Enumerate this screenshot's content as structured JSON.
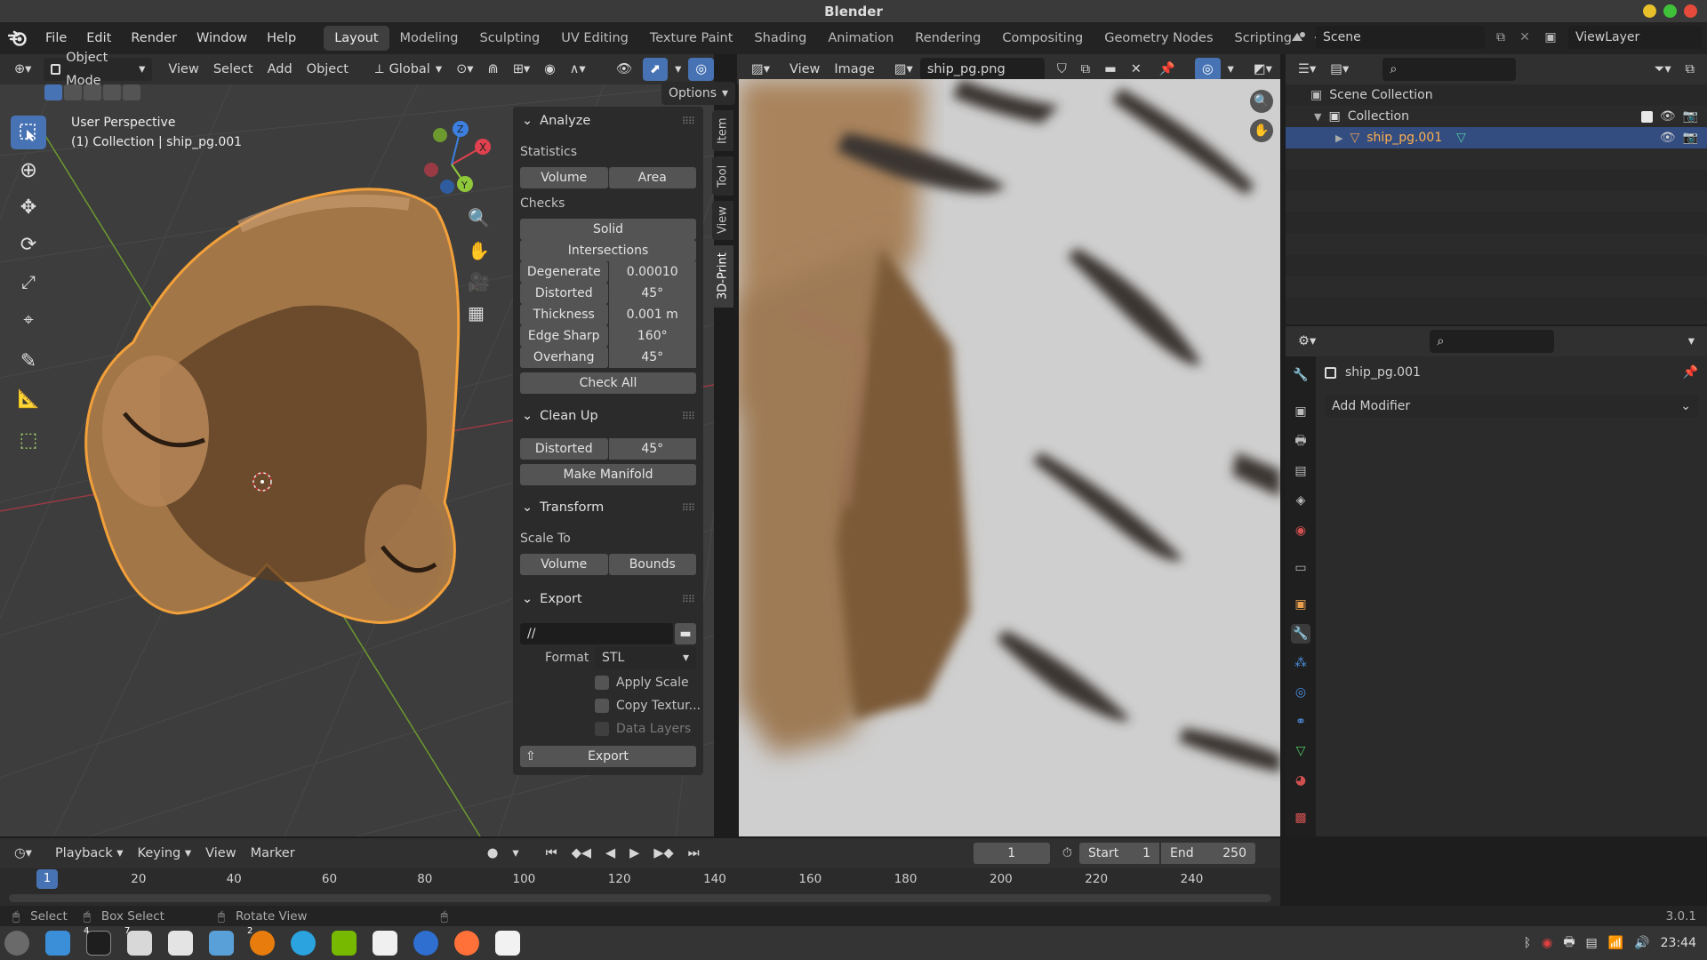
{
  "window": {
    "title": "Blender"
  },
  "menu": [
    "File",
    "Edit",
    "Render",
    "Window",
    "Help"
  ],
  "workspaces": [
    "Layout",
    "Modeling",
    "Sculpting",
    "UV Editing",
    "Texture Paint",
    "Shading",
    "Animation",
    "Rendering",
    "Compositing",
    "Geometry Nodes",
    "Scripting"
  ],
  "active_workspace": "Layout",
  "scene": {
    "label": "Scene",
    "viewlayer": "ViewLayer"
  },
  "viewport_header": {
    "mode": "Object Mode",
    "view": "View",
    "select": "Select",
    "add": "Add",
    "object": "Object",
    "orientation": "Global",
    "options": "Options"
  },
  "viewport": {
    "perspective": "User Perspective",
    "collection_info": "(1) Collection | ship_pg.001"
  },
  "side_tabs": [
    "Item",
    "Tool",
    "View",
    "3D-Print"
  ],
  "analyze": {
    "title": "Analyze",
    "statistics": "Statistics",
    "volume": "Volume",
    "area": "Area",
    "checks": "Checks",
    "solid": "Solid",
    "intersections": "Intersections",
    "rows": [
      {
        "label": "Degenerate",
        "value": "0.00010"
      },
      {
        "label": "Distorted",
        "value": "45°"
      },
      {
        "label": "Thickness",
        "value": "0.001 m"
      },
      {
        "label": "Edge Sharp",
        "value": "160°"
      },
      {
        "label": "Overhang",
        "value": "45°"
      }
    ],
    "check_all": "Check All"
  },
  "cleanup": {
    "title": "Clean Up",
    "distorted": "Distorted",
    "distorted_value": "45°",
    "make_manifold": "Make Manifold"
  },
  "transform": {
    "title": "Transform",
    "scale_to": "Scale To",
    "volume": "Volume",
    "bounds": "Bounds"
  },
  "export": {
    "title": "Export",
    "path": "//",
    "format_label": "Format",
    "format": "STL",
    "apply_scale": "Apply Scale",
    "copy_textures": "Copy Textur...",
    "data_layers": "Data Layers",
    "export_btn": "Export"
  },
  "image_editor": {
    "view": "View",
    "image": "Image",
    "filename": "ship_pg.png"
  },
  "outliner": {
    "scene_collection": "Scene Collection",
    "collection": "Collection",
    "object": "ship_pg.001"
  },
  "properties": {
    "object": "ship_pg.001",
    "add_modifier": "Add Modifier"
  },
  "timeline": {
    "playback": "Playback",
    "keying": "Keying",
    "view": "View",
    "marker": "Marker",
    "current_frame": "1",
    "start_label": "Start",
    "start": "1",
    "end_label": "End",
    "end": "250",
    "ticks": [
      "20",
      "40",
      "60",
      "80",
      "100",
      "120",
      "140",
      "160",
      "180",
      "200",
      "220",
      "240"
    ],
    "cursor": "1"
  },
  "statusbar": {
    "select": "Select",
    "box_select": "Box Select",
    "rotate_view": "Rotate View",
    "version": "3.0.1"
  },
  "taskbar": {
    "time": "23:44",
    "badges": {
      "terminal": "4",
      "files": "7",
      "blender": "2"
    }
  },
  "colors": {
    "accent": "#4772b3",
    "object_orange": "#e8a050",
    "selected_row": "#334d80",
    "axis_x": "#e0414f",
    "axis_y": "#8fc839",
    "axis_z": "#3c7fe0"
  }
}
